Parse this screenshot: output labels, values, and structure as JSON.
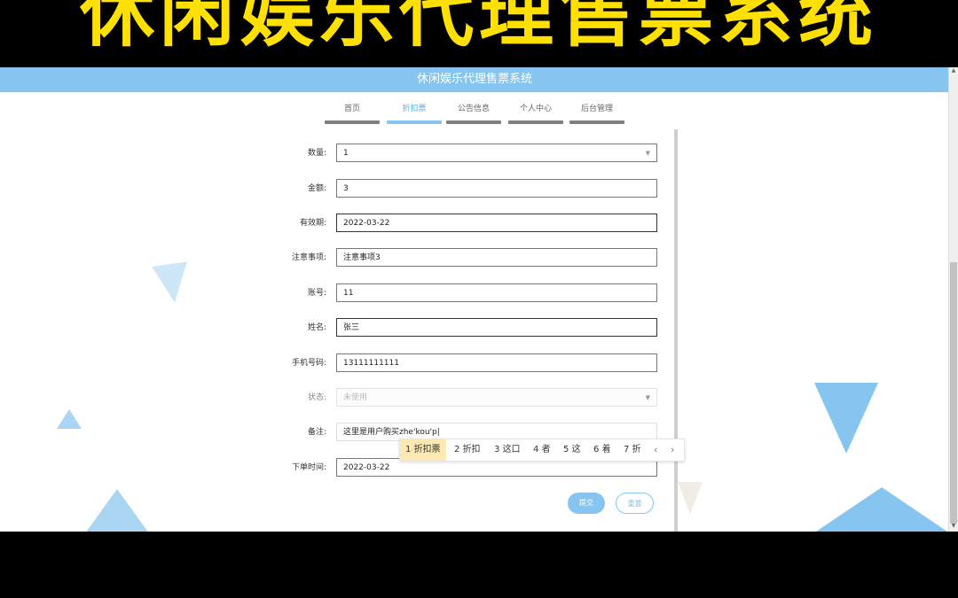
{
  "banner": {
    "title": "休闲娱乐代理售票系统",
    "color": "#ffe000"
  },
  "header": {
    "title": "休闲娱乐代理售票系统",
    "accent": "#86c5ef"
  },
  "nav": {
    "items": [
      {
        "label": "首页"
      },
      {
        "label": "折扣票"
      },
      {
        "label": "公告信息"
      },
      {
        "label": "个人中心"
      },
      {
        "label": "后台管理"
      }
    ],
    "active_index": 1
  },
  "form": {
    "quantity": {
      "label": "数量:",
      "value": "1"
    },
    "amount": {
      "label": "金额:",
      "value": "3"
    },
    "valid_until": {
      "label": "有效期:",
      "value": "2022-03-22"
    },
    "notes": {
      "label": "注意事项:",
      "value": "注意事项3"
    },
    "account": {
      "label": "账号:",
      "value": "11"
    },
    "name": {
      "label": "姓名:",
      "value": "张三"
    },
    "phone": {
      "label": "手机号码:",
      "value": "13111111111"
    },
    "status": {
      "label": "状态:",
      "value": "未使用"
    },
    "remark": {
      "label": "备注:",
      "value": "这里是用户购买zhe'kou'p"
    },
    "order_time": {
      "label": "下单时间:",
      "value": "2022-03-22"
    }
  },
  "ime": {
    "candidates": [
      {
        "index": "1",
        "text": "折扣票"
      },
      {
        "index": "2",
        "text": "折扣"
      },
      {
        "index": "3",
        "text": "这口"
      },
      {
        "index": "4",
        "text": "者"
      },
      {
        "index": "5",
        "text": "这"
      },
      {
        "index": "6",
        "text": "着"
      },
      {
        "index": "7",
        "text": "折"
      }
    ],
    "prev_icon": "chevron-left-icon",
    "next_icon": "chevron-right-icon"
  },
  "buttons": {
    "submit": "提交",
    "reset": "重置"
  }
}
